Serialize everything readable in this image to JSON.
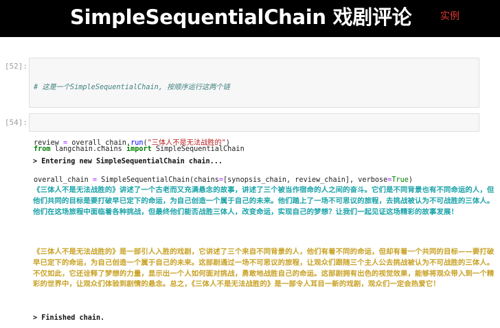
{
  "banner": {
    "title": "SimpleSequentialChain 戏剧评论",
    "tag": "实例"
  },
  "cells": [
    {
      "prompt": "[52]:",
      "comment": "# 这是一个SimpleSequentialChain, 按顺序运行这两个链",
      "import_kw_from": "from",
      "import_module": " langchain.chains ",
      "import_kw_import": "import",
      "import_name": " SimpleSequentialChain",
      "assign_prefix": "overall_chain ",
      "assign_eq": "=",
      "assign_call": " SimpleSequentialChain(chains",
      "assign_eq2": "=",
      "assign_args": "[synopsis_chain, review_chain], verbose",
      "assign_eq3": "=",
      "assign_bool": "True",
      "assign_close": ")"
    },
    {
      "prompt": "[54]:",
      "lhs": "review ",
      "eq": "=",
      "obj": " overall_chain.",
      "method": "run",
      "open": "(",
      "arg": "\"三体人不是无法战胜的\"",
      "close": ")"
    }
  ],
  "output": {
    "entering": "> Entering new SimpleSequentialChain chain...",
    "synopsis": "《三体人不是无法战胜的》讲述了一个古老而又充满悬念的故事，讲述了三个被当作宿命的人之间的奋斗。它们是不同背景也有不同命运的人，但他们共同的目标是要打破早已定下的命运，为自己创造一个属于自己的未来。他们踏上了一场不可思议的旅程，去挑战被认为不可战胜的三体人。他们在这场旅程中面临着各种挑战，但最终他们能否战胜三体人，改变命运，实现自己的梦想？让我们一起见证这场精彩的故事发展！",
    "review": "《三体人不是无法战胜的》是一部引人入胜的戏剧，它讲述了三个来自不同背景的人，他们有着不同的命运，但却有着一个共同的目标——要打破早已定下的命运，为自己创造一个属于自己的未来。这部剧通过一场不可思议的旅程，让观众们跟随三个主人公去挑战被认为不可战胜的三体人。不仅如此，它还诠释了梦想的力量，显示出一个人如何面对挑战，勇敢地战胜自己的命运。这部剧拥有出色的视觉效果，能够将观众带入到一个精彩的世界中，让观众们体验到剧情的悬念。总之，《三体人不是无法战胜的》是一部令人耳目一新的戏剧，观众们一定会热爱它！",
    "finished": "> Finished chain."
  },
  "colors": {
    "synopsis_text": "#1ba3a9",
    "review_text": "#c9a227",
    "banner_tag": "#e53935"
  }
}
